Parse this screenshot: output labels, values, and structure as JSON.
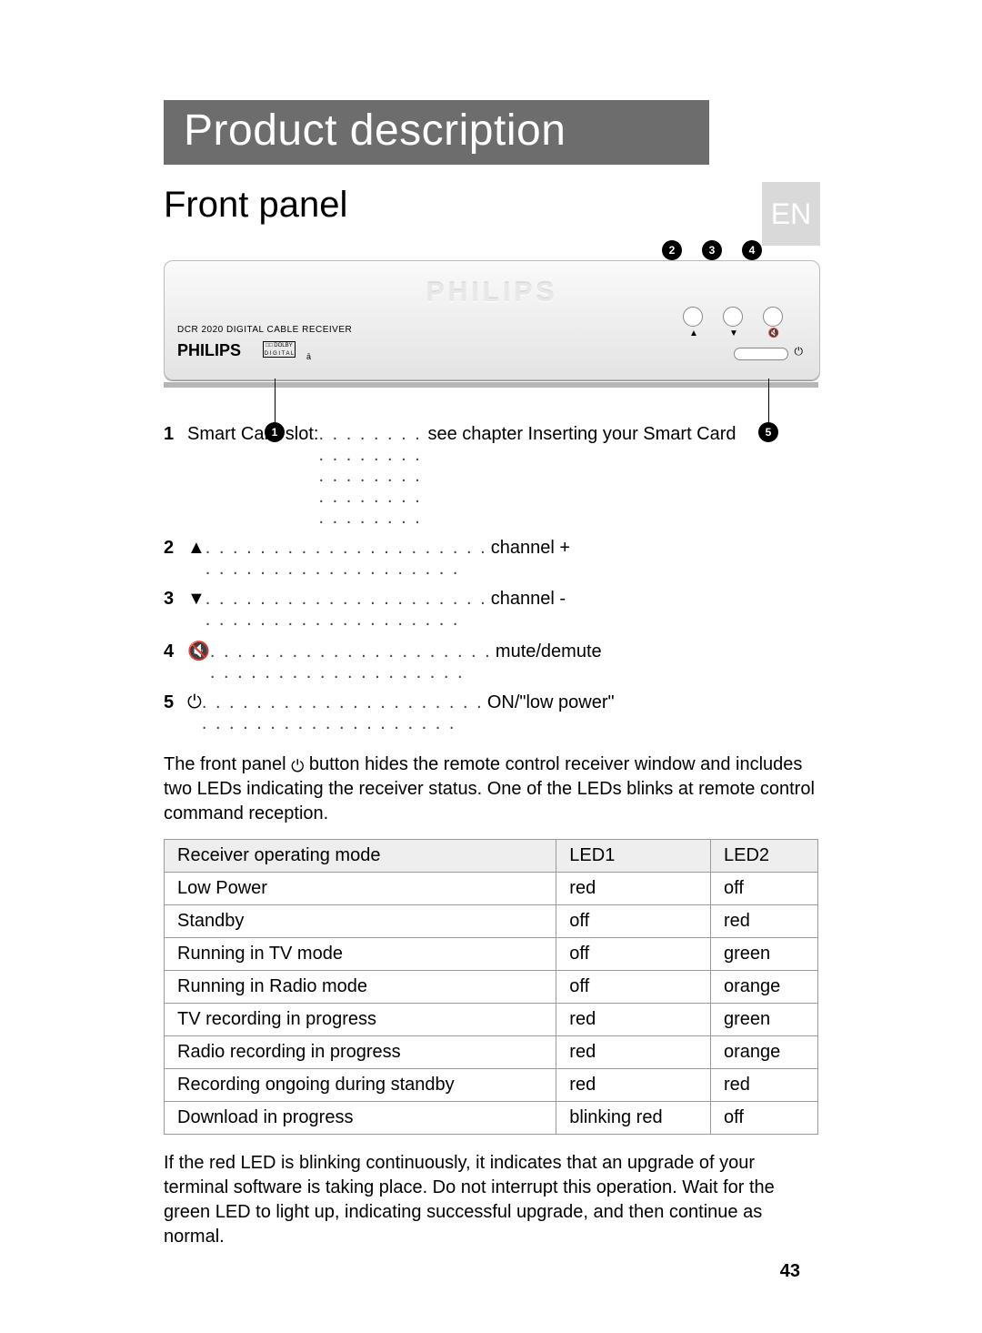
{
  "title": "Product description",
  "subtitle": "Front panel",
  "lang_tab": "EN",
  "device": {
    "model_line": "DCR 2020     DIGITAL CABLE RECEIVER",
    "brand": "PHILIPS",
    "engraved": "PHILIPS",
    "dolby": "□□ DOLBY\nD I G I T A L",
    "cas": "ā",
    "top_buttons": [
      {
        "sym": "▲"
      },
      {
        "sym": "▼"
      },
      {
        "sym": "🔇"
      }
    ],
    "power_sym": "⏻"
  },
  "callouts_top": [
    "2",
    "3",
    "4"
  ],
  "callouts_bottom_left": "1",
  "callouts_bottom_right": "5",
  "legend": [
    {
      "num": "1",
      "key": "Smart Card slot:",
      "val": "see chapter Inserting your Smart Card",
      "dots": "short"
    },
    {
      "num": "2",
      "key": "▲",
      "val": "channel +",
      "dots": "long"
    },
    {
      "num": "3",
      "key": "▼",
      "val": "channel -",
      "dots": "long"
    },
    {
      "num": "4",
      "key": "🔇",
      "val": "mute/demute",
      "dots": "long"
    },
    {
      "num": "5",
      "key": "⏻",
      "val": "ON/\"low power\"",
      "dots": "long"
    }
  ],
  "paragraph_before_icon": "The front panel ",
  "paragraph_icon": "⏻",
  "paragraph_after_icon": " button hides the remote control receiver window and includes two LEDs indicating the receiver status. One of the LEDs blinks at remote control command reception.",
  "table": {
    "headers": [
      "Receiver operating mode",
      "LED1",
      "LED2"
    ],
    "rows": [
      [
        "Low Power",
        "red",
        "off"
      ],
      [
        "Standby",
        "off",
        "red"
      ],
      [
        "Running in TV mode",
        "off",
        "green"
      ],
      [
        "Running in Radio mode",
        "off",
        "orange"
      ],
      [
        "TV recording in progress",
        "red",
        "green"
      ],
      [
        "Radio recording in progress",
        "red",
        "orange"
      ],
      [
        "Recording ongoing during standby",
        "red",
        "red"
      ],
      [
        "Download in progress",
        "blinking red",
        "off"
      ]
    ]
  },
  "footer_paragraph": "If the red LED is blinking continuously, it indicates that an upgrade of your terminal software is taking place. Do not interrupt this operation. Wait for the green LED to light up, indicating successful upgrade, and then continue as normal.",
  "page_number": "43",
  "dots_filler": ". . . . . . . . . . . . . . . . . . . . . . . . . . . . . . . . . . . . . . . ."
}
